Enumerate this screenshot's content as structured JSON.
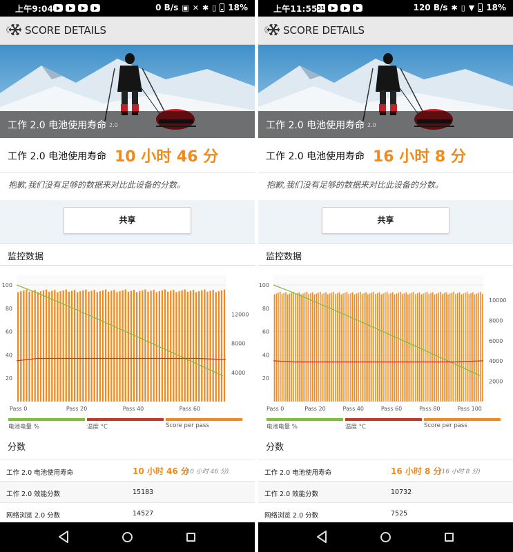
{
  "phones": [
    {
      "status": {
        "time": "上午9:04",
        "net": "0 B/s",
        "battery": "18%",
        "extra_icons": [
          "hd-icon",
          "x-icon",
          "bluetooth-icon",
          "vibrate-icon"
        ]
      },
      "topbar": {
        "title": "SCORE DETAILS"
      },
      "hero": {
        "caption": "工作 2.0 电池使用寿命",
        "version": "2.0"
      },
      "score": {
        "label": "工作 2.0 电池使用寿命",
        "value": "10 小时 46 分"
      },
      "sorry": "抱歉,我们没有足够的数据来对比此设备的分数。",
      "share": "共享",
      "monitor_title": "监控数据",
      "legend": [
        "电池电量 %",
        "温度 °C",
        "Score per pass"
      ],
      "scores_title": "分数",
      "scores": [
        {
          "name": "工作 2.0 电池使用寿命",
          "value": "10 小时 46 分",
          "sub": "(10 小时 46 分)"
        },
        {
          "name": "工作 2.0 效能分数",
          "value": "15183"
        },
        {
          "name": "网络浏览 2.0 分数",
          "value": "14527"
        }
      ],
      "chart_data": {
        "type": "bar",
        "title": "",
        "left_axis": {
          "ticks": [
            20,
            40,
            60,
            80,
            100
          ],
          "range": [
            0,
            100
          ]
        },
        "right_axis": {
          "ticks": [
            4000,
            8000,
            12000
          ],
          "range": [
            0,
            16000
          ]
        },
        "x_ticks": [
          "Pass 0",
          "Pass 20",
          "Pass 40",
          "Pass 60"
        ],
        "passes": 74,
        "series": [
          {
            "name": "Score per pass",
            "color": "#f08a1c",
            "axis": "right",
            "value_approx": 15200
          },
          {
            "name": "电池电量 %",
            "color": "#7fbf3a",
            "axis": "left",
            "from": 100,
            "to": 22
          },
          {
            "name": "温度 °C",
            "color": "#c23a2a",
            "axis": "left",
            "from": 35,
            "plateau": 37,
            "to": 36
          }
        ]
      }
    },
    {
      "status": {
        "time": "上午11:55",
        "net": "120 B/s",
        "battery": "18%",
        "extra_icons": [
          "bluetooth-icon",
          "vibrate-icon",
          "wifi-icon"
        ]
      },
      "topbar": {
        "title": "SCORE DETAILS"
      },
      "hero": {
        "caption": "工作 2.0 电池使用寿命",
        "version": "2.0"
      },
      "score": {
        "label": "工作 2.0 电池使用寿命",
        "value": "16 小时 8 分"
      },
      "sorry": "抱歉,我们没有足够的数据来对比此设备的分数。",
      "share": "共享",
      "monitor_title": "监控数据",
      "legend": [
        "电池电量 %",
        "温度 °C",
        "Score per pass"
      ],
      "scores_title": "分数",
      "scores": [
        {
          "name": "工作 2.0 电池使用寿命",
          "value": "16 小时 8 分",
          "sub": "(16 小时 8 分)"
        },
        {
          "name": "工作 2.0 效能分数",
          "value": "10732"
        },
        {
          "name": "网络浏览 2.0 分数",
          "value": "7525"
        }
      ],
      "chart_data": {
        "type": "bar",
        "title": "",
        "left_axis": {
          "ticks": [
            20,
            40,
            60,
            80,
            100
          ],
          "range": [
            0,
            100
          ]
        },
        "right_axis": {
          "ticks": [
            2000,
            4000,
            6000,
            8000,
            10000
          ],
          "range": [
            0,
            11500
          ]
        },
        "x_ticks": [
          "Pass 0",
          "Pass 20",
          "Pass 40",
          "Pass 60",
          "Pass 80",
          "Pass 100"
        ],
        "passes": 110,
        "series": [
          {
            "name": "Score per pass",
            "color": "#f08a1c",
            "axis": "right",
            "value_approx": 10700
          },
          {
            "name": "电池电量 %",
            "color": "#7fbf3a",
            "axis": "left",
            "from": 100,
            "to": 22
          },
          {
            "name": "温度 °C",
            "color": "#c23a2a",
            "axis": "left",
            "from": 35,
            "plateau": 34,
            "to": 35
          }
        ]
      }
    }
  ]
}
